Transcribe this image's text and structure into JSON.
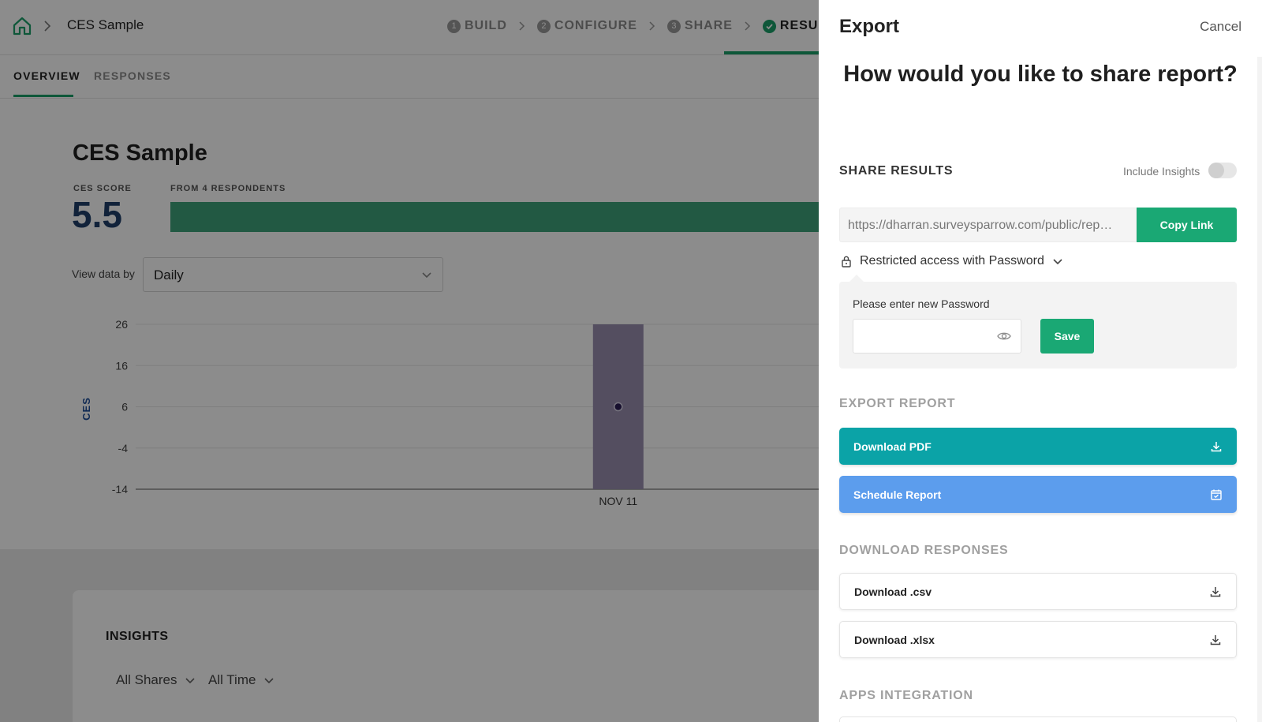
{
  "header": {
    "breadcrumb_title": "CES Sample",
    "steps": [
      {
        "num": "1",
        "label": "BUILD"
      },
      {
        "num": "2",
        "label": "CONFIGURE"
      },
      {
        "num": "3",
        "label": "SHARE"
      },
      {
        "num": "",
        "label": "RESULTS"
      }
    ]
  },
  "tabs": {
    "overview": "OVERVIEW",
    "responses": "RESPONSES"
  },
  "summary": {
    "title": "CES Sample",
    "score_label": "CES SCORE",
    "score_value": "5.5",
    "respondents_label": "FROM 4 RESPONDENTS",
    "view_by_label": "View data by",
    "view_by_value": "Daily"
  },
  "chart_data": {
    "type": "bar",
    "ylabel": "CES",
    "yticks": [
      26,
      16,
      6,
      -4,
      -14
    ],
    "ylim": [
      -14,
      26
    ],
    "categories": [
      "NOV 11"
    ],
    "bar_range": {
      "low": -14,
      "high": 26
    },
    "points": [
      {
        "x": "NOV 11",
        "y": 6
      }
    ],
    "bar_color": "#9a8eb0",
    "point_color": "#2a1d55"
  },
  "insights": {
    "title": "INSIGHTS",
    "filter_shares": "All Shares",
    "filter_time": "All Time"
  },
  "panel": {
    "title": "Export",
    "cancel": "Cancel",
    "question": "How would you like to share report?",
    "share_results": "SHARE RESULTS",
    "include_insights": "Include Insights",
    "include_insights_on": false,
    "share_link": "https://dharran.surveysparrow.com/public/rep…",
    "copy_link": "Copy Link",
    "restricted_access": "Restricted access with Password",
    "password_label": "Please enter new Password",
    "password_value": "",
    "save": "Save",
    "export_report": "EXPORT REPORT",
    "download_pdf": "Download PDF",
    "schedule_report": "Schedule Report",
    "download_responses": "DOWNLOAD RESPONSES",
    "download_csv": "Download .csv",
    "download_xlsx": "Download .xlsx",
    "apps_integration": "APPS INTEGRATION"
  },
  "colors": {
    "brand_green": "#1aa874",
    "pdf_teal": "#0ba3a7",
    "schedule_blue": "#5c9ded",
    "score_navy": "#1f3f6b"
  }
}
